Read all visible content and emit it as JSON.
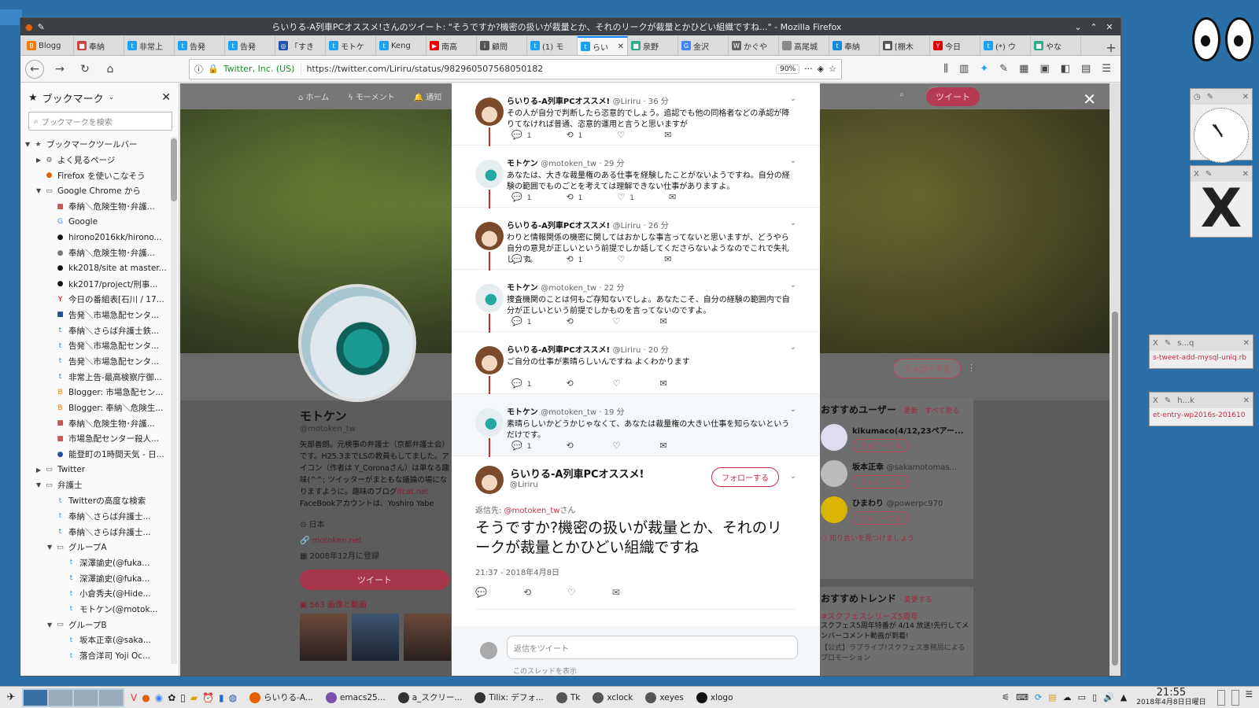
{
  "window": {
    "title": "らいりる-A列車PCオススメ!さんのツイート: \"そうですか?機密の扱いが裁量とか、それのリークが裁量とかひどい組織ですね...\" - Mozilla Firefox"
  },
  "tabs": [
    {
      "label": "Blogg",
      "color": "#f47c00",
      "icon": "B"
    },
    {
      "label": "奉納",
      "color": "#c44",
      "icon": "■"
    },
    {
      "label": "非常上",
      "color": "#1da1f2",
      "icon": "t"
    },
    {
      "label": "告発",
      "color": "#1da1f2",
      "icon": "t"
    },
    {
      "label": "告発",
      "color": "#1da1f2",
      "icon": "t"
    },
    {
      "label": "「すき",
      "color": "#2255aa",
      "icon": "◎"
    },
    {
      "label": "モトケ",
      "color": "#1da1f2",
      "icon": "t"
    },
    {
      "label": "Keng",
      "color": "#1da1f2",
      "icon": "t"
    },
    {
      "label": "南高",
      "color": "#e00",
      "icon": "▶"
    },
    {
      "label": "顧問",
      "color": "#555",
      "icon": "i"
    },
    {
      "label": "(1) モ",
      "color": "#1da1f2",
      "icon": "t"
    },
    {
      "label": "らい",
      "color": "#1da1f2",
      "icon": "t",
      "active": true
    },
    {
      "label": "泉野",
      "color": "#3a8",
      "icon": "■"
    },
    {
      "label": "金沢",
      "color": "#4285f4",
      "icon": "G"
    },
    {
      "label": "かぐや",
      "color": "#666",
      "icon": "W"
    },
    {
      "label": "高尾城",
      "color": "#888",
      "icon": ""
    },
    {
      "label": "奉納",
      "color": "#1b8ad6",
      "icon": "t"
    },
    {
      "label": "[棚木",
      "color": "#555",
      "icon": "■"
    },
    {
      "label": "今日",
      "color": "#d00",
      "icon": "Y"
    },
    {
      "label": "(*) ウ",
      "color": "#1da1f2",
      "icon": "t"
    },
    {
      "label": "やな",
      "color": "#3a8",
      "icon": "■"
    }
  ],
  "navbar": {
    "identity": "Twitter, Inc. (US)",
    "url": "https://twitter.com/Liriru/status/982960507568050182",
    "zoom": "90%"
  },
  "sidebar": {
    "title": "ブックマーク",
    "search_placeholder": "ブックマークを検索",
    "items": [
      {
        "label": "ブックマークツールバー",
        "level": 0,
        "twisty": "▼",
        "icon": "★",
        "color": "#555"
      },
      {
        "label": "よく見るページ",
        "level": 1,
        "twisty": "▶",
        "icon": "⚙",
        "color": "#555"
      },
      {
        "label": "Firefox を使いこなそう",
        "level": 1,
        "twisty": "",
        "icon": "●",
        "color": "#e66000"
      },
      {
        "label": "Google Chrome から",
        "level": 1,
        "twisty": "▼",
        "icon": "▭",
        "color": "#555"
      },
      {
        "label": "奉納＼危険生物･弁護...",
        "level": 2,
        "twisty": "",
        "icon": "■",
        "color": "#c55"
      },
      {
        "label": "Google",
        "level": 2,
        "twisty": "",
        "icon": "G",
        "color": "#4285f4"
      },
      {
        "label": "hirono2016kk/hirono...",
        "level": 2,
        "twisty": "",
        "icon": "●",
        "color": "#111"
      },
      {
        "label": "奉納＼危険生物･弁護...",
        "level": 2,
        "twisty": "",
        "icon": "●",
        "color": "#777"
      },
      {
        "label": "kk2018/site at master...",
        "level": 2,
        "twisty": "",
        "icon": "●",
        "color": "#111"
      },
      {
        "label": "kk2017/project/刑事...",
        "level": 2,
        "twisty": "",
        "icon": "●",
        "color": "#111"
      },
      {
        "label": "今日の番組表[石川 / 17...",
        "level": 2,
        "twisty": "",
        "icon": "Y",
        "color": "#d00"
      },
      {
        "label": "告発＼市場急配センタ...",
        "level": 2,
        "twisty": "",
        "icon": "■",
        "color": "#2a4a9a"
      },
      {
        "label": "奉納＼さらば弁護士鉄...",
        "level": 2,
        "twisty": "",
        "icon": "t",
        "color": "#1b8ad6"
      },
      {
        "label": "告発＼市場急配センタ...",
        "level": 2,
        "twisty": "",
        "icon": "t",
        "color": "#1b8ad6"
      },
      {
        "label": "告発＼市場急配センタ...",
        "level": 2,
        "twisty": "",
        "icon": "t",
        "color": "#1da1f2"
      },
      {
        "label": "非常上告-最高検察庁御...",
        "level": 2,
        "twisty": "",
        "icon": "t",
        "color": "#1b8ad6"
      },
      {
        "label": "Blogger: 市場急配セン...",
        "level": 2,
        "twisty": "",
        "icon": "B",
        "color": "#f47c00"
      },
      {
        "label": "Blogger: 奉納＼危険生...",
        "level": 2,
        "twisty": "",
        "icon": "B",
        "color": "#f47c00"
      },
      {
        "label": "奉納＼危険生物･弁護...",
        "level": 2,
        "twisty": "",
        "icon": "■",
        "color": "#c55"
      },
      {
        "label": "市場急配センター殺人...",
        "level": 2,
        "twisty": "",
        "icon": "■",
        "color": "#c55"
      },
      {
        "label": "能登町の1時間天気 - 日...",
        "level": 2,
        "twisty": "",
        "icon": "●",
        "color": "#2a4a9a"
      },
      {
        "label": "Twitter",
        "level": 1,
        "twisty": "▶",
        "icon": "▭",
        "color": "#555"
      },
      {
        "label": "弁護士",
        "level": 1,
        "twisty": "▼",
        "icon": "▭",
        "color": "#555"
      },
      {
        "label": "Twitterの高度な検索",
        "level": 2,
        "twisty": "",
        "icon": "t",
        "color": "#1da1f2"
      },
      {
        "label": "奉納＼さらば弁護士...",
        "level": 2,
        "twisty": "",
        "icon": "t",
        "color": "#1da1f2"
      },
      {
        "label": "奉納＼さらば弁護士...",
        "level": 2,
        "twisty": "",
        "icon": "t",
        "color": "#1b8ad6"
      },
      {
        "label": "グループA",
        "level": 2,
        "twisty": "▼",
        "icon": "▭",
        "color": "#555"
      },
      {
        "label": "深澤諭史(@fuka...",
        "level": 3,
        "twisty": "",
        "icon": "t",
        "color": "#1da1f2"
      },
      {
        "label": "深澤諭史(@fuka...",
        "level": 3,
        "twisty": "",
        "icon": "t",
        "color": "#1b8ad6"
      },
      {
        "label": "小倉秀夫(@Hide...",
        "level": 3,
        "twisty": "",
        "icon": "t",
        "color": "#1da1f2"
      },
      {
        "label": "モトケン(@motok...",
        "level": 3,
        "twisty": "",
        "icon": "t",
        "color": "#1da1f2"
      },
      {
        "label": "グループB",
        "level": 2,
        "twisty": "▼",
        "icon": "▭",
        "color": "#555"
      },
      {
        "label": "坂本正幸(@saka...",
        "level": 3,
        "twisty": "",
        "icon": "t",
        "color": "#1da1f2"
      },
      {
        "label": "落合洋司 Yoji Oc...",
        "level": 3,
        "twisty": "",
        "icon": "t",
        "color": "#1da1f2"
      }
    ]
  },
  "twitter_nav": {
    "home": "ホーム",
    "moments": "モーメント",
    "notifications": "通知",
    "tweet_button": "ツイート"
  },
  "profile": {
    "name": "モトケン",
    "handle": "@motoken_tw",
    "bio": "矢部善朗。元検事の弁護士（京都弁護士会）です。H25.3までLSの教員もしてました。アイコン（作者は Y_Coronaさん）は単なる趣味(^^; ツイッターがまともな議論の場になりますように。趣味のブログ",
    "bio_link": "ltcat.net",
    "bio_tail": "FaceBookアカウントは、Yoshiro Yabe",
    "location": "日本",
    "site": "motoken.net",
    "joined": "2008年12月に登録",
    "tweet_button": "ツイート",
    "media": "563 画像と動画",
    "follow": "フォローする"
  },
  "recommend": {
    "title": "おすすめユーザー",
    "links": "· 更新 · すべて見る",
    "users": [
      {
        "name": "kikumaco(4/12,23ペアー...",
        "handle": ""
      },
      {
        "name": "坂本正幸",
        "handle": "@sakamotomas..."
      },
      {
        "name": "ひまわり",
        "handle": "@powerpc970"
      }
    ],
    "follow": "フォローする",
    "find": "知り合いを見つけましょう"
  },
  "trends": {
    "title": "おすすめトレンド",
    "change": "· 変更する",
    "t1": "#スクフェスシリーズ5周年",
    "t2": "スクフェス5周年特番が 4/14 放送!先行してメンバーコメント動画が到着!",
    "t3": "【公式】ラブライブ!スクフェス事務局によるプロモーション"
  },
  "replies": [
    {
      "who": "rai",
      "name": "らいりる-A列車PCオススメ!",
      "handle": "@Liriru · 36 分",
      "body": "その人が自分で判断したら恣意的でしょう。追認でも他の同格者などの承認が降りてなければ普通、恣意的運用と言うと思いますが",
      "reply": "1",
      "rt": "1",
      "like": ""
    },
    {
      "who": "moto",
      "name": "モトケン",
      "handle": "@motoken_tw · 29 分",
      "body": "あなたは、大きな裁量権のある仕事を経験したことがないようですね。自分の経験の範囲でものごとを考えては理解できない仕事がありますよ。",
      "reply": "1",
      "rt": "1",
      "like": "1"
    },
    {
      "who": "rai",
      "name": "らいりる-A列車PCオススメ!",
      "handle": "@Liriru · 26 分",
      "body": "わりと情報関係の機密に関してはおかしな事言ってないと思いますが、どうやら自分の意見が正しいという前提でしか話してくださらないようなのでこれで失礼します。",
      "reply": "1",
      "rt": "1",
      "like": ""
    },
    {
      "who": "moto",
      "name": "モトケン",
      "handle": "@motoken_tw · 22 分",
      "body": "捜査機関のことは何もご存知ないでしょ。あなたこそ、自分の経験の範囲内で自分が正しいという前提でしかものを言ってないのですよ。",
      "reply": "1",
      "rt": "",
      "like": ""
    },
    {
      "who": "rai",
      "name": "らいりる-A列車PCオススメ!",
      "handle": "@Liriru · 20 分",
      "body": "ご自分の仕事が素晴らしいんですね よくわかります",
      "reply": "1",
      "rt": "",
      "like": ""
    },
    {
      "who": "moto",
      "name": "モトケン",
      "handle": "@motoken_tw · 19 分",
      "body": "素晴らしいかどうかじゃなくて、あなたは裁量権の大きい仕事を知らないというだけです。",
      "reply": "1",
      "rt": "",
      "like": "",
      "highlight": true
    }
  ],
  "main_tweet": {
    "name": "らいりる-A列車PCオススメ!",
    "handle": "@Liriru",
    "follow": "フォローする",
    "reply_to_prefix": "返信先: ",
    "reply_to": "@motoken_tw",
    "reply_to_suffix": "さん",
    "text": "そうですか?機密の扱いが裁量とか、それのリークが裁量とかひどい組織ですね",
    "time": "21:37 - 2018年4月8日"
  },
  "reply_box": {
    "placeholder": "返信をツイート",
    "more": "このスレッドを表示"
  },
  "widgets": {
    "xlabel1": "s-tweet-add-mysql-uniq.rb",
    "xlabel2": "et-entry-wp2016s-201610",
    "head1": "s...q",
    "head2": "h...k"
  },
  "taskbar": {
    "tasks": [
      {
        "label": "らいりる-A...",
        "color": "#e66000"
      },
      {
        "label": "emacs25...",
        "color": "#7b52ab"
      },
      {
        "label": "a_スクリー...",
        "color": "#333"
      },
      {
        "label": "Tilix: デフォ...",
        "color": "#333"
      },
      {
        "label": "Tk",
        "color": "#555"
      },
      {
        "label": "xclock",
        "color": "#555"
      },
      {
        "label": "xeyes",
        "color": "#555"
      },
      {
        "label": "xlogo",
        "color": "#111"
      }
    ],
    "time": "21:55",
    "date": "2018年4月8日日曜日"
  }
}
